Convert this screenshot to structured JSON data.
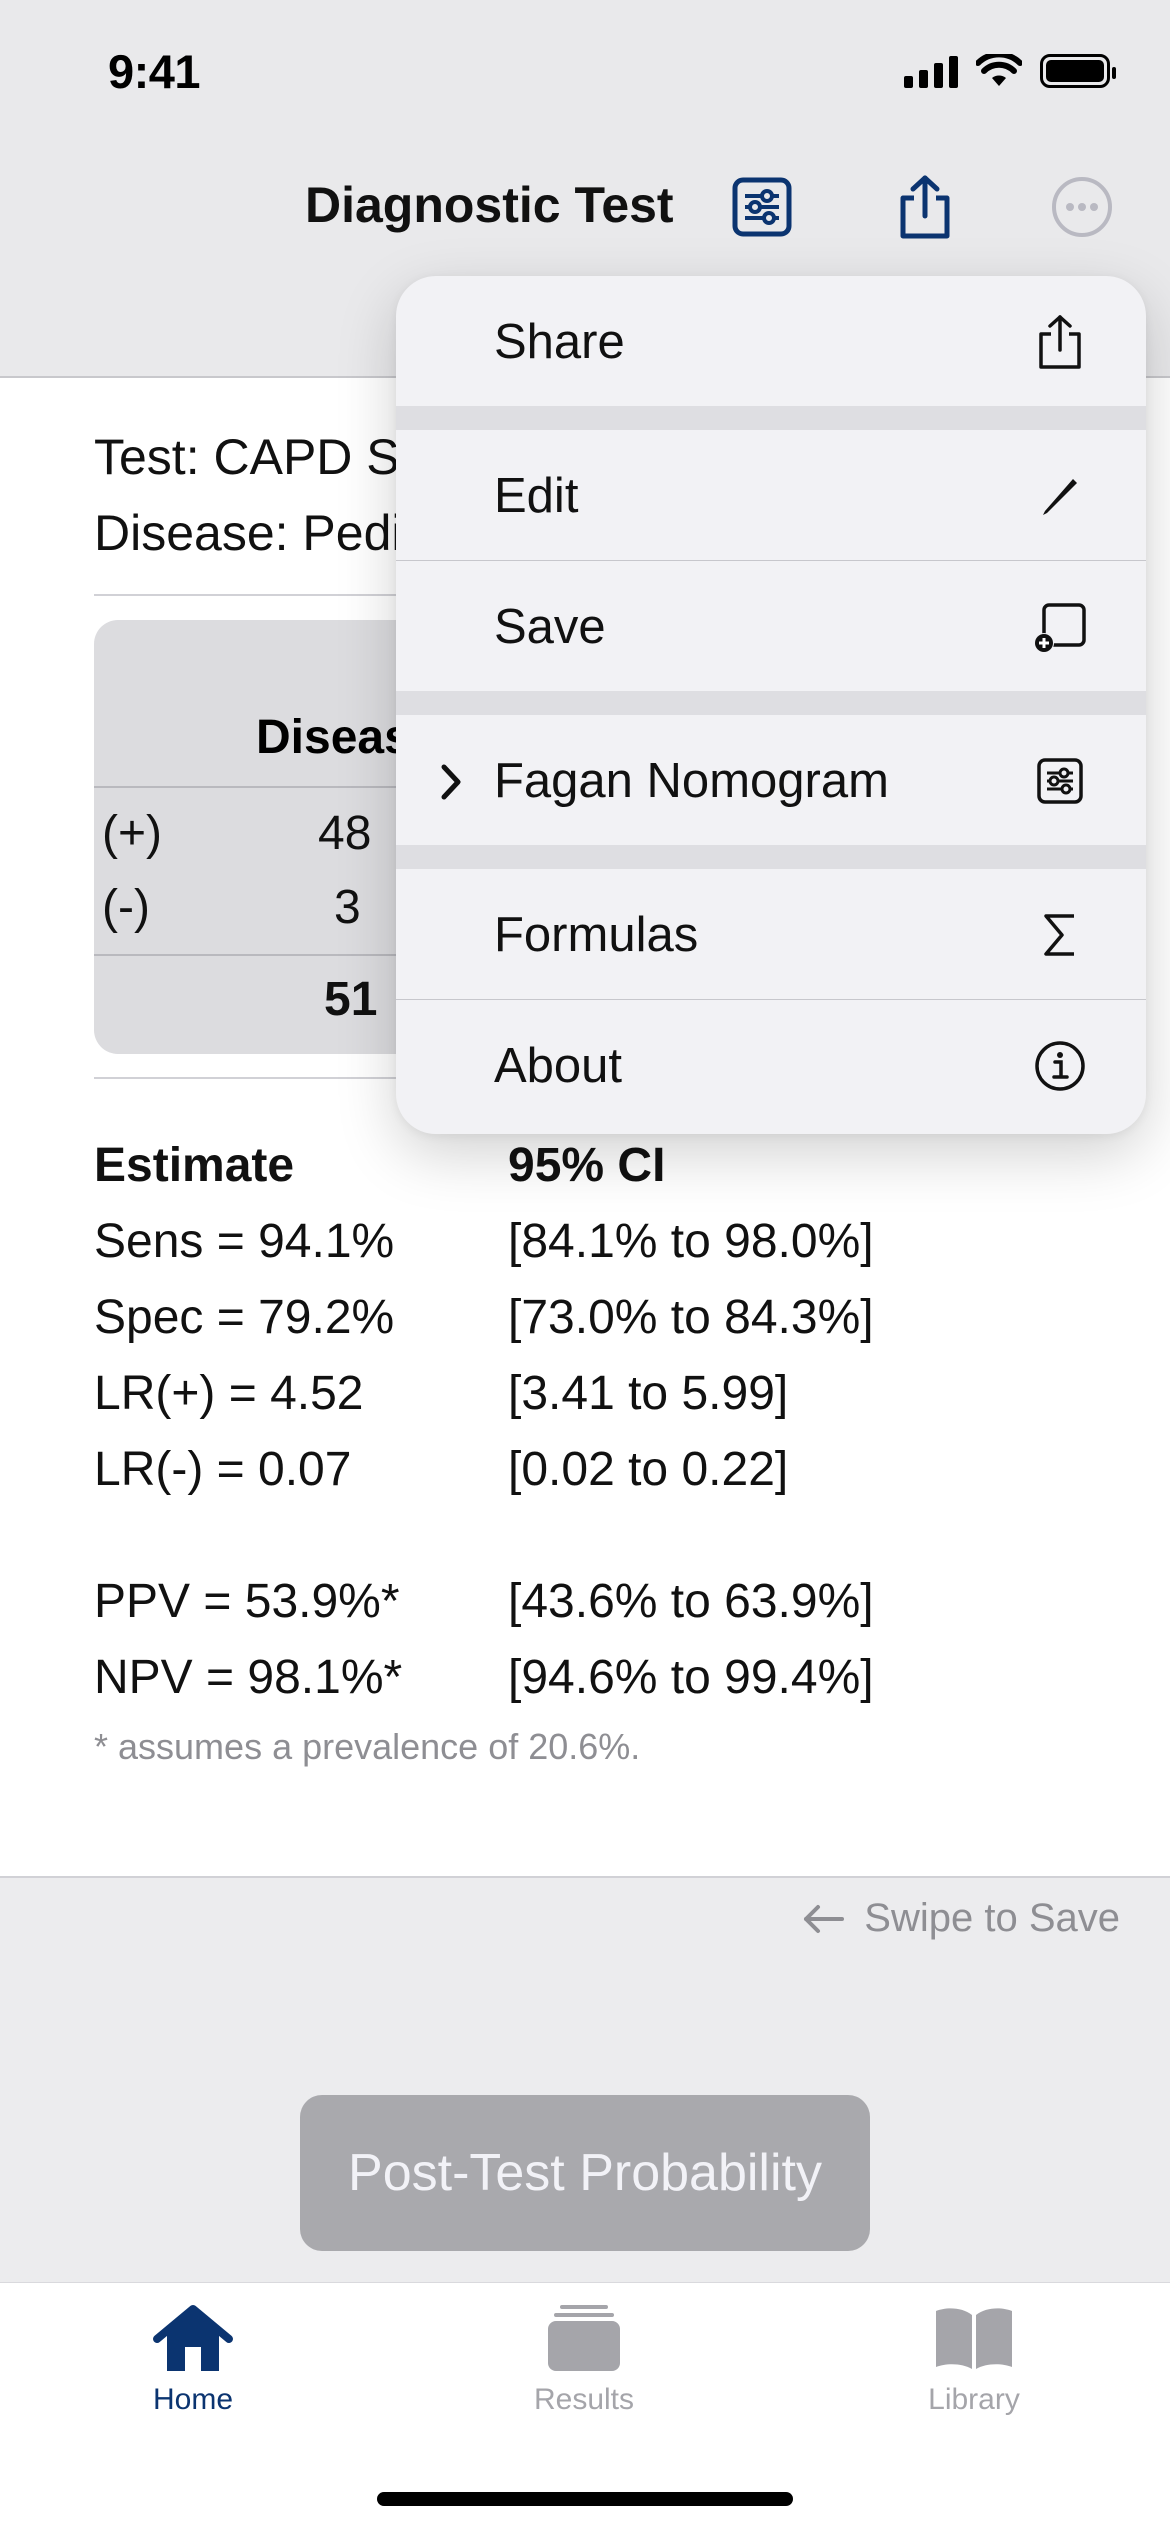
{
  "status": {
    "time": "9:41"
  },
  "nav": {
    "title": "Diagnostic Test"
  },
  "meta": {
    "test_line": "Test: CAPD S",
    "disease_line": "Disease: Pedi"
  },
  "table": {
    "header": "Diseas",
    "rows": [
      {
        "label": "(+)",
        "value": "48"
      },
      {
        "label": "(-)",
        "value": "3"
      }
    ],
    "total": "51"
  },
  "stats": {
    "estimate_header": "Estimate",
    "ci_header": "95% CI",
    "rows": [
      {
        "estimate": "Sens = 94.1%",
        "ci": "[84.1% to 98.0%]"
      },
      {
        "estimate": "Spec = 79.2%",
        "ci": "[73.0% to 84.3%]"
      },
      {
        "estimate": "LR(+) = 4.52",
        "ci": "[3.41 to 5.99]"
      },
      {
        "estimate": "LR(-) = 0.07",
        "ci": "[0.02 to 0.22]"
      }
    ],
    "pv_rows": [
      {
        "estimate": "PPV = 53.9%*",
        "ci": "[43.6% to 63.9%]"
      },
      {
        "estimate": "NPV = 98.1%*",
        "ci": "[94.6% to 99.4%]"
      }
    ],
    "footnote": "* assumes a prevalence of 20.6%."
  },
  "swipe": {
    "label": "Swipe to Save"
  },
  "cta": {
    "label": "Post-Test Probability"
  },
  "menu": {
    "items": [
      {
        "label": "Share",
        "icon": "share-icon"
      },
      {
        "label": "Edit",
        "icon": "pencil-icon"
      },
      {
        "label": "Save",
        "icon": "save-icon"
      },
      {
        "label": "Fagan Nomogram",
        "icon": "sliders-icon"
      },
      {
        "label": "Formulas",
        "icon": "sigma-icon"
      },
      {
        "label": "About",
        "icon": "info-icon"
      }
    ]
  },
  "tabs": [
    {
      "label": "Home",
      "active": true
    },
    {
      "label": "Results",
      "active": false
    },
    {
      "label": "Library",
      "active": false
    }
  ],
  "colors": {
    "accent": "#0b3470",
    "inactive": "#a5a5aa",
    "button_disabled": "#a9a9ad"
  }
}
